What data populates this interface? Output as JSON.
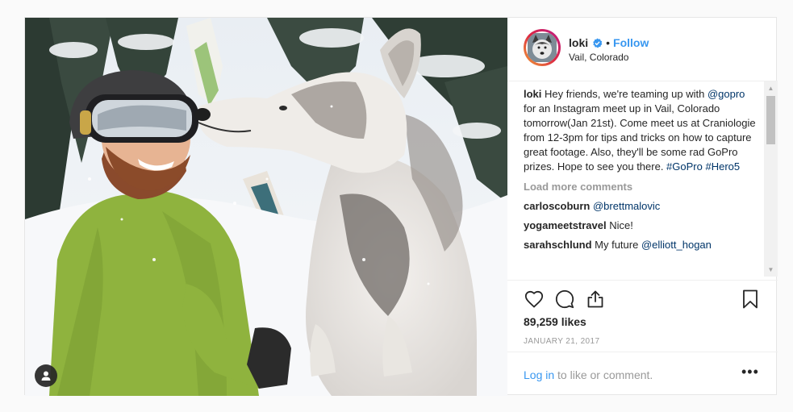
{
  "post": {
    "username": "loki",
    "follow_label": "Follow",
    "separator": "•",
    "location": "Vail, Colorado"
  },
  "caption": {
    "username": "loki",
    "text_1": " Hey friends, we're teaming up with ",
    "mention": "@gopro",
    "text_2": " for an Instagram meet up in Vail, Colorado tomorrow(Jan 21st). Come meet us at Craniologie from 12-3pm for tips and tricks on how to capture great footage. Also, they'll be some rad GoPro prizes. Hope to see you there. ",
    "hashtag_1": "#GoPro",
    "hashtag_2": "#Hero5"
  },
  "load_more_label": "Load more comments",
  "comments": [
    {
      "user": "carloscoburn",
      "text": "",
      "link": "@brettmalovic"
    },
    {
      "user": "yogameetstravel",
      "text": " Nice!",
      "link": ""
    },
    {
      "user": "sarahschlund",
      "text": " My future ",
      "link": "@elliott_hogan"
    }
  ],
  "likes": "89,259 likes",
  "date": "JANUARY 21, 2017",
  "login": {
    "link": "Log in",
    "text": " to like or comment."
  },
  "more_label": "•••",
  "icons": {
    "tag": "user-tag-icon",
    "like": "heart-icon",
    "comment": "comment-bubble-icon",
    "share": "share-icon",
    "save": "bookmark-icon",
    "verified": "verified-badge-icon"
  },
  "colors": {
    "link_blue": "#3897f0",
    "hashtag": "#003569",
    "muted": "#999999",
    "text": "#262626"
  }
}
